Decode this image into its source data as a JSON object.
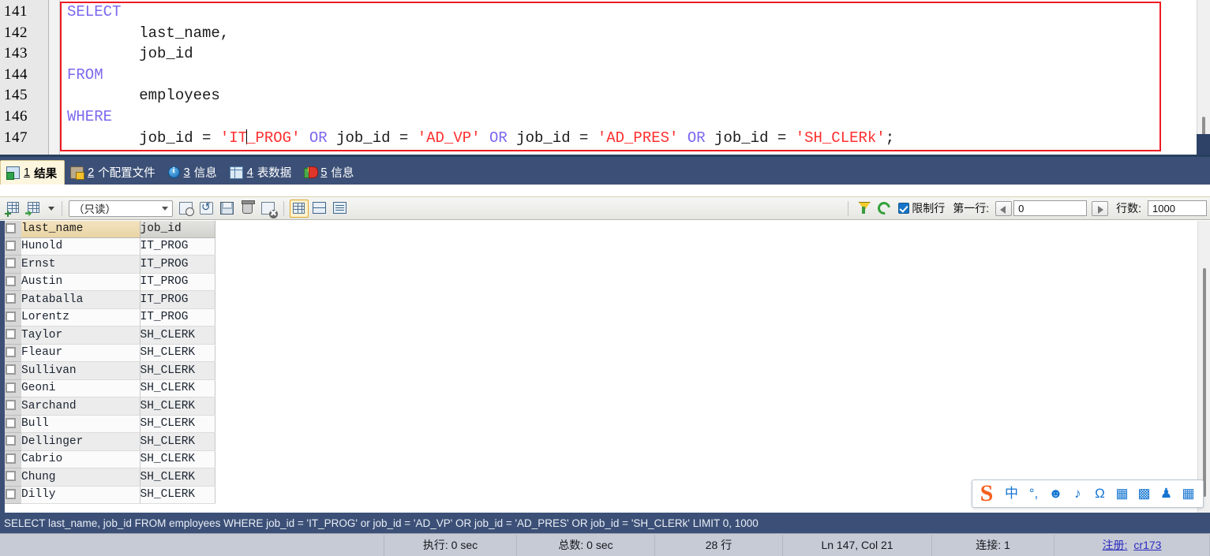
{
  "editor": {
    "line_numbers": [
      "141",
      "142",
      "143",
      "144",
      "145",
      "146",
      "147"
    ],
    "lines": [
      {
        "indent": 0,
        "tokens": [
          {
            "t": "kw",
            "v": "SELECT"
          }
        ]
      },
      {
        "indent": 0,
        "tokens": [
          {
            "t": "plain",
            "v": "        last_name,"
          }
        ]
      },
      {
        "indent": 0,
        "tokens": [
          {
            "t": "plain",
            "v": "        job_id"
          }
        ]
      },
      {
        "indent": 0,
        "tokens": [
          {
            "t": "kw",
            "v": "FROM"
          }
        ]
      },
      {
        "indent": 0,
        "tokens": [
          {
            "t": "plain",
            "v": "        employees"
          }
        ]
      },
      {
        "indent": 0,
        "tokens": [
          {
            "t": "kw",
            "v": "WHERE"
          }
        ]
      },
      {
        "indent": 0,
        "tokens": [
          {
            "t": "plain",
            "v": "        job_id = "
          },
          {
            "t": "str",
            "v": "'IT"
          },
          {
            "t": "caret",
            "v": ""
          },
          {
            "t": "str",
            "v": "_PROG'"
          },
          {
            "t": "plain",
            "v": " "
          },
          {
            "t": "kw",
            "v": "OR"
          },
          {
            "t": "plain",
            "v": " job_id = "
          },
          {
            "t": "str",
            "v": "'AD_VP'"
          },
          {
            "t": "plain",
            "v": " "
          },
          {
            "t": "kw",
            "v": "OR"
          },
          {
            "t": "plain",
            "v": " job_id = "
          },
          {
            "t": "str",
            "v": "'AD_PRES'"
          },
          {
            "t": "plain",
            "v": " "
          },
          {
            "t": "kw",
            "v": "OR"
          },
          {
            "t": "plain",
            "v": " job_id = "
          },
          {
            "t": "str",
            "v": "'SH_CLERk'"
          },
          {
            "t": "plain",
            "v": ";"
          }
        ]
      }
    ]
  },
  "tabs": [
    {
      "num": "1",
      "label": "结果",
      "icon": "result-grid-icon",
      "active": true
    },
    {
      "num": "2",
      "label": "个配置文件",
      "icon": "profile-icon",
      "active": false
    },
    {
      "num": "3",
      "label": "信息",
      "icon": "info-icon",
      "active": false
    },
    {
      "num": "4",
      "label": "表数据",
      "icon": "table-data-icon",
      "active": false
    },
    {
      "num": "5",
      "label": "信息",
      "icon": "chart-info-icon",
      "active": false
    }
  ],
  "gridbar": {
    "mode_value": "（只读）",
    "limit_label": "限制行",
    "first_row_label": "第一行:",
    "first_row_value": "0",
    "row_count_label": "行数:",
    "row_count_value": "1000",
    "buttons": [
      {
        "name": "new-grid-row-button",
        "title": ""
      },
      {
        "name": "export-grid-button",
        "title": ""
      },
      {
        "name": "insert-record-button",
        "title": ""
      },
      {
        "name": "refresh-record-button",
        "title": ""
      },
      {
        "name": "save-record-button",
        "title": ""
      },
      {
        "name": "delete-record-button",
        "title": ""
      },
      {
        "name": "cancel-edit-button",
        "title": ""
      },
      {
        "name": "grid-view-button",
        "title": ""
      },
      {
        "name": "form-view-button",
        "title": ""
      },
      {
        "name": "text-view-button",
        "title": ""
      }
    ]
  },
  "table": {
    "columns": [
      "last_name",
      "job_id"
    ],
    "rows": [
      [
        "Hunold",
        "IT_PROG"
      ],
      [
        "Ernst",
        "IT_PROG"
      ],
      [
        "Austin",
        "IT_PROG"
      ],
      [
        "Pataballa",
        "IT_PROG"
      ],
      [
        "Lorentz",
        "IT_PROG"
      ],
      [
        "Taylor",
        "SH_CLERK"
      ],
      [
        "Fleaur",
        "SH_CLERK"
      ],
      [
        "Sullivan",
        "SH_CLERK"
      ],
      [
        "Geoni",
        "SH_CLERK"
      ],
      [
        "Sarchand",
        "SH_CLERK"
      ],
      [
        "Bull",
        "SH_CLERK"
      ],
      [
        "Dellinger",
        "SH_CLERK"
      ],
      [
        "Cabrio",
        "SH_CLERK"
      ],
      [
        "Chung",
        "SH_CLERK"
      ],
      [
        "Dilly",
        "SH_CLERK"
      ]
    ]
  },
  "ime": {
    "logo": "S",
    "items": [
      {
        "glyph": "中",
        "name": "chinese-mode-icon"
      },
      {
        "glyph": "°,",
        "name": "punctuation-mode-icon"
      },
      {
        "glyph": "☻",
        "name": "emoji-icon"
      },
      {
        "glyph": "♪",
        "name": "voice-input-icon"
      },
      {
        "glyph": "Ω",
        "name": "symbol-input-icon"
      },
      {
        "glyph": "▦",
        "name": "soft-keyboard-icon"
      },
      {
        "glyph": "▩",
        "name": "user-profile-icon"
      },
      {
        "glyph": "♟",
        "name": "skin-icon"
      },
      {
        "glyph": "▦",
        "name": "toolbox-icon"
      }
    ]
  },
  "sql_status": "SELECT last_name, job_id FROM employees WHERE job_id = 'IT_PROG' or job_id = 'AD_VP' OR job_id = 'AD_PRES' OR job_id = 'SH_CLERk' LIMIT 0, 1000",
  "statusbar": {
    "exec_time": "执行: 0 sec",
    "total_time": "总数: 0 sec",
    "rows": "28 行",
    "cursor": "Ln 147, Col 21",
    "connection": "连接: 1",
    "register_label": "注册:",
    "register_value": "cr173"
  },
  "colors": {
    "tab_bar": "#3c5077",
    "active_tab": "#fdf6df",
    "keyword": "#7b68ee",
    "string": "#ff2f2f",
    "redbox": "#ec1c24",
    "accent_blue": "#1575d1",
    "ime_orange": "#f4601a"
  }
}
